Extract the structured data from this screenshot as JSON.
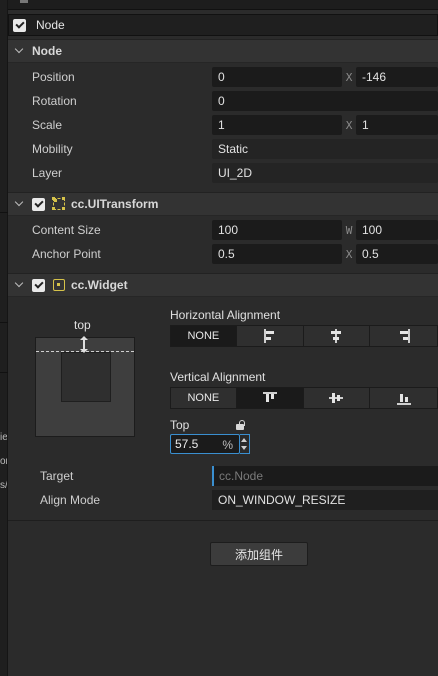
{
  "left_clip": {
    "items": [
      "ie",
      "or",
      "s/"
    ]
  },
  "node_header": {
    "name": "Node",
    "enabled": true
  },
  "node_section": {
    "title": "Node",
    "position": {
      "label": "Position",
      "x": "0",
      "x_axis": "X",
      "y": "-146"
    },
    "rotation": {
      "label": "Rotation",
      "value": "0"
    },
    "scale": {
      "label": "Scale",
      "x": "1",
      "x_axis": "X",
      "y": "1"
    },
    "mobility": {
      "label": "Mobility",
      "value": "Static"
    },
    "layer": {
      "label": "Layer",
      "value": "UI_2D"
    }
  },
  "uitransform": {
    "title": "cc.UITransform",
    "enabled": true,
    "icon": "uitransform-icon",
    "content_size": {
      "label": "Content Size",
      "w": "100",
      "w_axis": "W",
      "h": "100"
    },
    "anchor_point": {
      "label": "Anchor Point",
      "x": "0.5",
      "x_axis": "X",
      "y": "0.5"
    }
  },
  "widget": {
    "title": "cc.Widget",
    "enabled": true,
    "icon": "widget-icon",
    "preview_caption": "top",
    "horizontal": {
      "label": "Horizontal Alignment",
      "none_label": "NONE",
      "selected": "NONE"
    },
    "vertical": {
      "label": "Vertical Alignment",
      "none_label": "NONE",
      "selected": "top"
    },
    "top": {
      "label": "Top",
      "value": "57.5",
      "unit": "%"
    },
    "target": {
      "label": "Target",
      "placeholder": "cc.Node"
    },
    "align_mode": {
      "label": "Align Mode",
      "value": "ON_WINDOW_RESIZE"
    }
  },
  "add_component": {
    "label": "添加组件"
  },
  "colors": {
    "accent": "#3a8fd0",
    "icon_yellow": "#d6c34a",
    "panel": "#2b2b2b"
  }
}
